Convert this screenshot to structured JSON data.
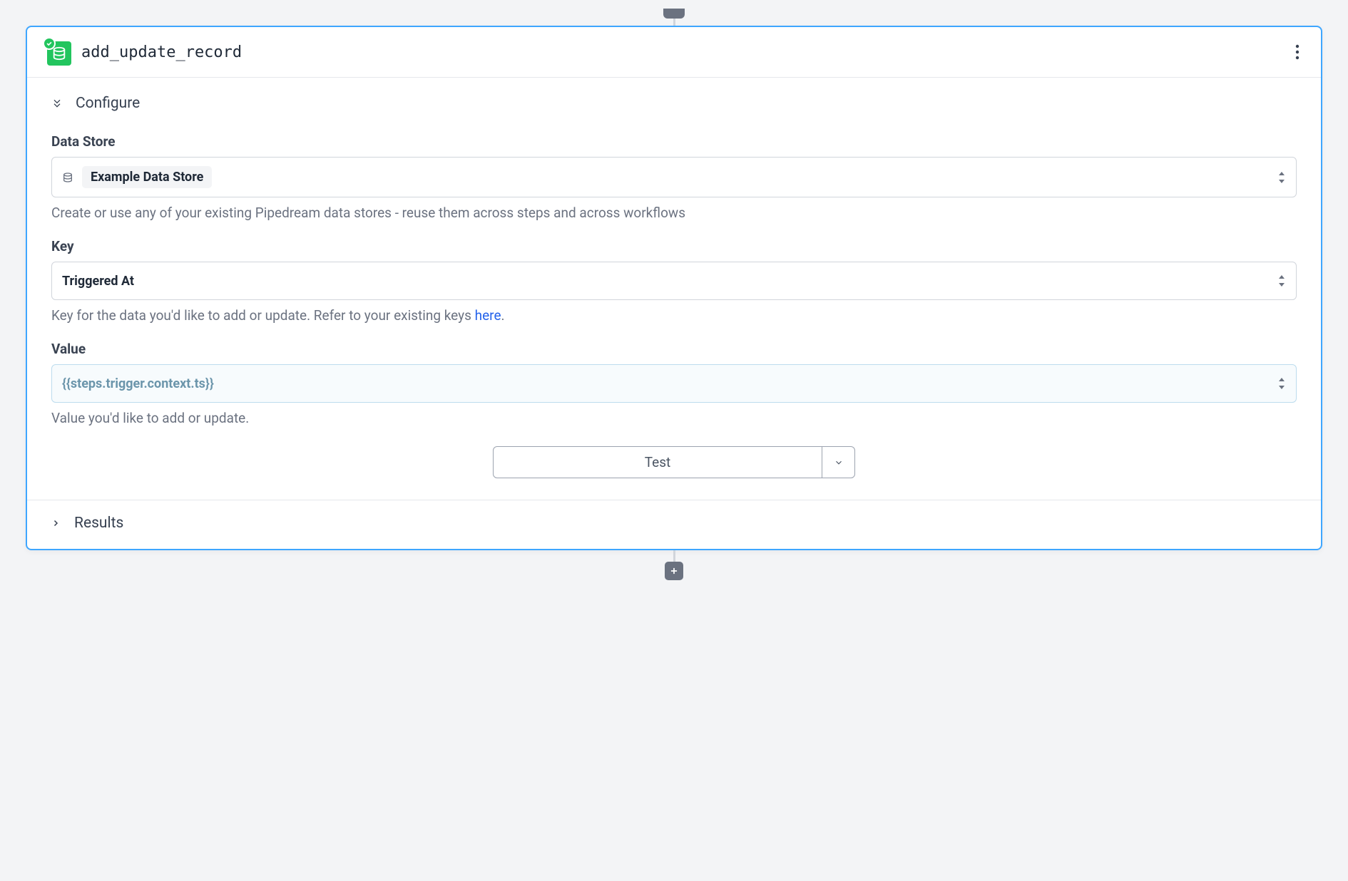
{
  "step": {
    "title": "add_update_record"
  },
  "configure": {
    "heading": "Configure",
    "fields": {
      "data_store": {
        "label": "Data Store",
        "value": "Example Data Store",
        "helper": "Create or use any of your existing Pipedream data stores - reuse them across steps and across workflows"
      },
      "key": {
        "label": "Key",
        "value": "Triggered At",
        "helper_prefix": "Key for the data you'd like to add or update. Refer to your existing keys ",
        "helper_link": "here",
        "helper_suffix": "."
      },
      "value": {
        "label": "Value",
        "value": "{{steps.trigger.context.ts}}",
        "helper": "Value you'd like to add or update."
      }
    }
  },
  "actions": {
    "test": "Test"
  },
  "results": {
    "heading": "Results"
  }
}
